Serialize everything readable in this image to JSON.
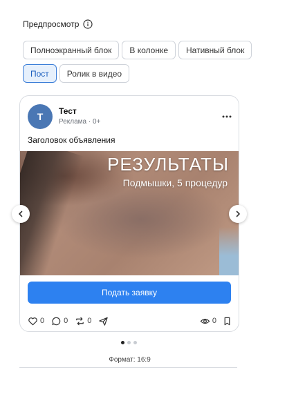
{
  "preview": {
    "title": "Предпросмотр",
    "info_icon": "info-icon"
  },
  "formats": [
    {
      "label": "Полноэкранный блок",
      "active": false
    },
    {
      "label": "В колонке",
      "active": false
    },
    {
      "label": "Нативный блок",
      "active": false
    },
    {
      "label": "Пост",
      "active": true
    },
    {
      "label": "Ролик в видео",
      "active": false
    }
  ],
  "post": {
    "avatar_letter": "Т",
    "name": "Тест",
    "meta": "Реклама · 0+",
    "more_icon": "more-horizontal-icon",
    "ad_title": "Заголовок объявления",
    "media": {
      "headline": "РЕЗУЛЬТАТЫ",
      "subheadline": "Подмышки, 5 процедур"
    },
    "cta_label": "Подать заявку",
    "actions": {
      "likes": "0",
      "comments": "0",
      "reposts": "0",
      "views": "0"
    }
  },
  "carousel": {
    "page_count": 3,
    "active_index": 0
  },
  "format_label": "Формат: 16:9",
  "colors": {
    "accent": "#2d81f0",
    "chip_active_bg": "#e6f0fc",
    "chip_active_border": "#3b7ed8",
    "avatar": "#4a77b4"
  }
}
